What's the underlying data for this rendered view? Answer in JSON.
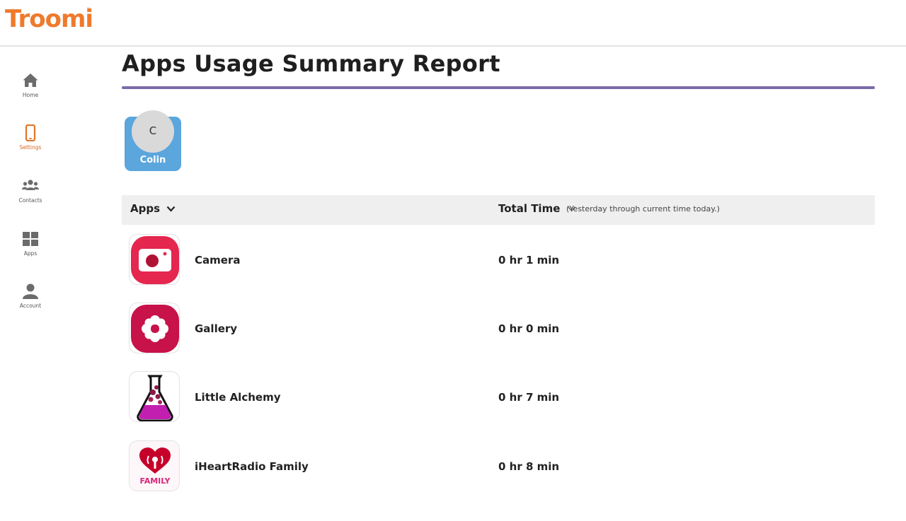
{
  "brand": {
    "logo_text": "Troomi",
    "tm": "™",
    "color": "#ef7a2c"
  },
  "sidebar": {
    "items": [
      {
        "label": "Home",
        "icon": "home-icon",
        "active": false
      },
      {
        "label": "Settings",
        "icon": "phone-icon",
        "active": true
      },
      {
        "label": "Contacts",
        "icon": "contacts-icon",
        "active": false
      },
      {
        "label": "Apps",
        "icon": "apps-grid-icon",
        "active": false
      },
      {
        "label": "Account",
        "icon": "account-icon",
        "active": false
      }
    ]
  },
  "page": {
    "title": "Apps Usage Summary Report",
    "accent_color": "#7b6aaa"
  },
  "user": {
    "initial": "C",
    "name": "Colin",
    "card_color": "#5ba6dd"
  },
  "table": {
    "columns": {
      "apps": "Apps",
      "total_time": "Total Time",
      "time_note": "(Yesterday through current time today.)"
    },
    "rows": [
      {
        "name": "Camera",
        "time": "0 hr 1 min",
        "icon": "camera-app-icon"
      },
      {
        "name": "Gallery",
        "time": "0 hr 0 min",
        "icon": "gallery-app-icon"
      },
      {
        "name": "Little Alchemy",
        "time": "0 hr 7 min",
        "icon": "little-alchemy-app-icon"
      },
      {
        "name": "iHeartRadio Family",
        "time": "0 hr 8 min",
        "icon": "iheartradio-family-app-icon",
        "icon_text": "FAMILY"
      }
    ]
  }
}
